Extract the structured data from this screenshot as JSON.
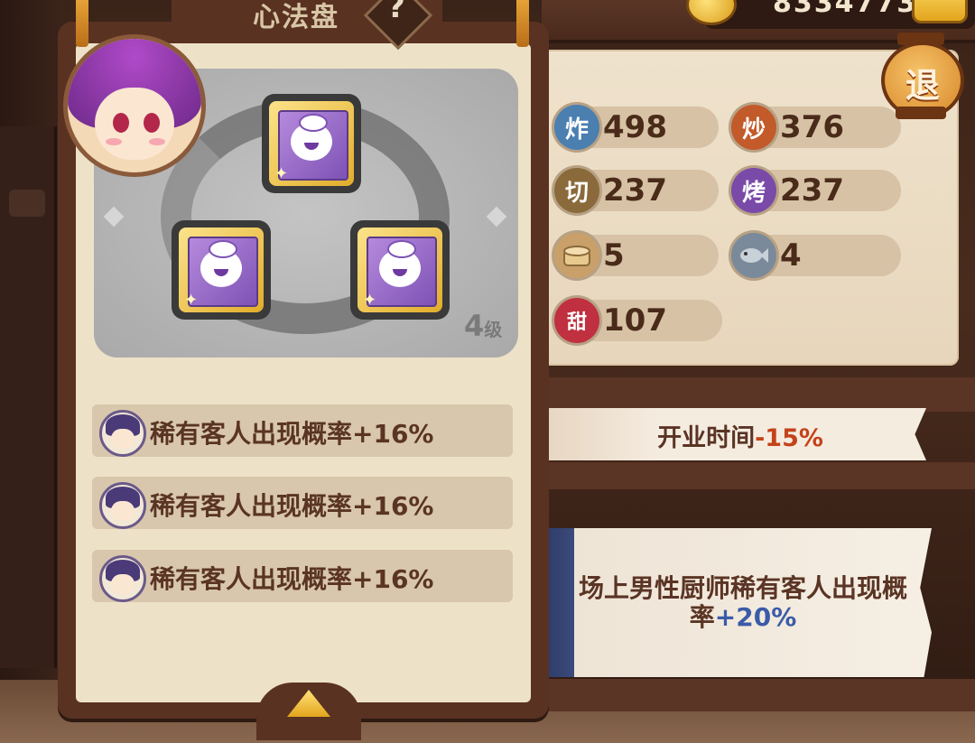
{
  "currency": {
    "value": "8334773"
  },
  "stats_panel": {
    "exit_label": "退",
    "stats": [
      {
        "icon_label": "炸",
        "value": "498",
        "color": "#4a7fb0"
      },
      {
        "icon_label": "炒",
        "value": "376",
        "color": "#c25a2a"
      },
      {
        "icon_label": "切",
        "value": "237",
        "color": "#8a6a3a"
      },
      {
        "icon_label": "烤",
        "value": "237",
        "color": "#7a4aa8"
      },
      {
        "icon_label": "",
        "value": "5",
        "icon": "steamer-icon",
        "color": "#c9a06a"
      },
      {
        "icon_label": "",
        "value": "4",
        "icon": "fish-icon",
        "color": "#7a8a9a"
      },
      {
        "icon_label": "甜",
        "value": "107",
        "color": "#c03040"
      }
    ],
    "banner1": {
      "text": "开业时间",
      "pct": "-15%"
    },
    "banner2": {
      "text": "场上男性厨师稀有客人出现概率",
      "pct": "+20%"
    }
  },
  "card": {
    "title": "心法盘",
    "help": "?",
    "level": "4",
    "level_unit": "级",
    "slots": [
      {
        "icon": "bun-icon"
      },
      {
        "icon": "bun-icon"
      },
      {
        "icon": "bun-icon"
      }
    ],
    "bonuses": [
      {
        "text": "稀有客人出现概率+16%"
      },
      {
        "text": "稀有客人出现概率+16%"
      },
      {
        "text": "稀有客人出现概率+16%"
      }
    ]
  }
}
